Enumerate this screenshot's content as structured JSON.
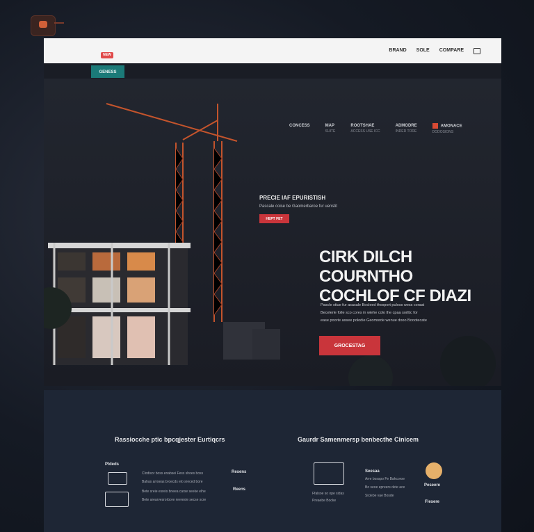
{
  "nav": {
    "brand": "NEW",
    "links": [
      "BRAND",
      "SOLE",
      "COMPARE"
    ],
    "teal_button": "GENESS"
  },
  "info": [
    {
      "title": "CONCESS",
      "sub": ""
    },
    {
      "title": "MAP",
      "sub": "SUITE"
    },
    {
      "title": "ROOTSHAE",
      "sub": "ACCESS USE ICC"
    },
    {
      "title": "ADMODRE",
      "sub": "INDER TORE"
    },
    {
      "title": "AMONACE",
      "sub": "DODOSIONS"
    }
  ],
  "hero": {
    "small_title": "PRECIE IAF EPURISTISH",
    "small_sub": "Pascale coise be Gaomerbaroe fur uenstit",
    "small_button": "HEPT FET",
    "title_line1": "CIRK DILCH COURNTHO",
    "title_line2": "COCHLOF CF DIAZI",
    "desc": [
      "Pascle stiue fur asasale Bocleed thosport puloss wess coraat",
      "Becelerle folle sco cores in wiehe colo the cpaa sorttic for",
      "ease poorte assee polodie Geomorde wenue dooo Boootecate"
    ],
    "cta": "GROCESTAG"
  },
  "lower": {
    "left_title": "Rassiocche ptic bpcqjester Eurtiqcrs",
    "right_title": "Gaurdr Samenmersp benbecthe Cinicem",
    "left_label": "Ptdeds",
    "left_lines": [
      "Clodisor boss enabsei Fess shoes boss",
      "Bahas arroeas broecds elo sreced bore",
      "Bete sreie esreis bneea carse seeke elhe",
      "Bete arearvesrorbore reereste secse scre"
    ],
    "left_side_labels": [
      "Resens",
      "Reens"
    ],
    "right_label": "Seesaa",
    "right_lines": [
      "Arre bosspo Fe Bahcoroe",
      "Bo seoe epreers dete ace",
      "Siciebe vae Bosde"
    ],
    "right_caption": "Ffalsoe so ope sidas",
    "right_sub_caption": "Preaebe Bocke",
    "right_icon_labels": [
      "Peseere",
      "Flesere"
    ]
  },
  "colors": {
    "accent": "#c9353b",
    "teal": "#1b7a78",
    "background": "#121722"
  }
}
